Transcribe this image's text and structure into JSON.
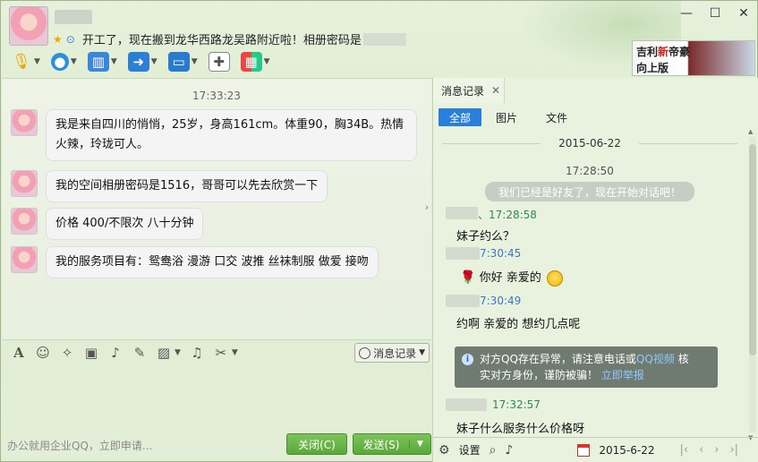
{
  "window": {
    "signature": "开工了，现在搬到龙华西路龙吴路附近啦！相册密码是",
    "controls": {
      "minimize": "—",
      "restore": "☐",
      "close": "✕"
    }
  },
  "toolbar": {
    "icons": [
      "microphone-icon",
      "webcam-icon",
      "screen-share-icon",
      "file-transfer-icon",
      "remote-assist-icon",
      "message-add-icon",
      "apps-grid-icon"
    ]
  },
  "ad": {
    "line1_a": "吉利",
    "line1_b": "新",
    "line1_c": "帝豪",
    "line2": "向上版"
  },
  "chat": {
    "timestamp": "17:33:23",
    "messages": [
      {
        "text_line1": "我是来自四川的悄悄，25岁，身高161cm。体重90，胸34B。热情",
        "text_line2": "火辣，玲珑可人。"
      },
      {
        "text": "我的空间相册密码是1516，哥哥可以先去欣赏一下"
      },
      {
        "text": "价格 400/不限次   八十分钟"
      },
      {
        "text": "我的服务项目有：鸳鸯浴  漫游  口交  波推  丝袜制服  做爱  接吻"
      }
    ]
  },
  "input_toolbar": {
    "history_label": "消息记录"
  },
  "bottom": {
    "promo": "办公就用企业QQ，立即申请...",
    "close_label": "关闭(C)",
    "send_label": "发送(S)"
  },
  "history": {
    "tab_label": "消息记录",
    "filters": [
      "全部",
      "图片",
      "文件"
    ],
    "date": "2015-06-22",
    "sys_time": "17:28:50",
    "sys_note": "我们已经是好友了，现在开始对话吧！",
    "entries": [
      {
        "meta": "、17:28:58",
        "text": "妹子约么？"
      },
      {
        "meta": "7:30:45",
        "text": "你好 亲爱的"
      },
      {
        "meta": "7:30:49",
        "text": "约啊 亲爱的 想约几点呢"
      },
      {
        "meta": "17:32:57",
        "text": "妹子什么服务什么价格呀"
      }
    ],
    "warning": {
      "text1": "对方QQ存在异常，请注意电话或",
      "link1": "QQ视频",
      "text2": "核",
      "text3": "实对方身份，谨防被骗！",
      "link2": "立即举报"
    },
    "settings_label": "设置",
    "current_date": "2015-6-22"
  }
}
